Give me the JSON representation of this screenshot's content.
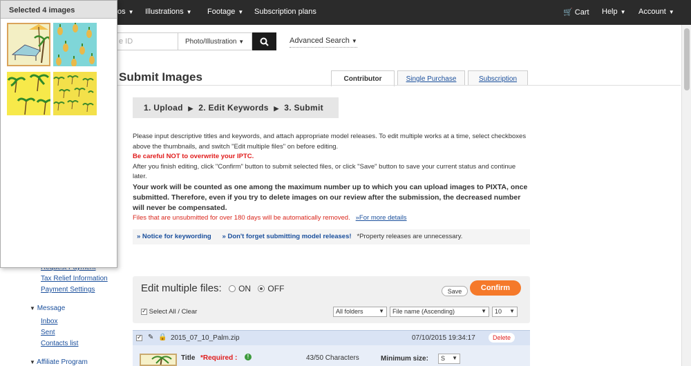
{
  "nav": {
    "items": [
      {
        "label": "os",
        "dropdown": true
      },
      {
        "label": "Illustrations",
        "dropdown": true
      },
      {
        "label": "Footage",
        "dropdown": true
      },
      {
        "label": "Subscription plans",
        "dropdown": false
      }
    ],
    "cart": "Cart",
    "help": "Help",
    "account": "Account"
  },
  "search": {
    "placeholder": "e ID",
    "type_value": "Photo/Illustration",
    "advanced": "Advanced Search"
  },
  "page": {
    "title": "Submit Images",
    "tabs": [
      "Contributor",
      "Single Purchase",
      "Subscription"
    ]
  },
  "steps": {
    "step1": "1. Upload",
    "step2": "2. Edit Keywords",
    "step3": "3. Submit"
  },
  "instructions": {
    "line1": "Please input descriptive titles and keywords, and attach appropriate model releases. To edit multiple works at a time, select checkboxes above the thumbnails, and switch \"Edit multiple files\" on before editing.",
    "warning": "Be careful NOT to overwrite your IPTC.",
    "line2": "After you finish editing, click \"Confirm\" button to submit selected files, or click \"Save\" button to save your current status and continue later.",
    "bold": "Your work will be counted as one among the maximum number up to which you can upload images to PIXTA, once submitted. Therefore, even if you try to delete images on our review after the submission, the decreased number will never be compensated.",
    "removal": "Files that are unsubmitted for over 180 days will be automatically removed.",
    "more_details": "»For more details"
  },
  "notice": {
    "keywording": "» Notice for keywording",
    "releases": "» Don't forget submitting model releases!",
    "property": "*Property releases are unnecessary."
  },
  "sidebar": {
    "partial": "Request Payment",
    "tax": "Tax Relief Information",
    "payment": "Payment Settings",
    "message_heading": "Message",
    "inbox": "Inbox",
    "sent": "Sent",
    "contacts": "Contacts list",
    "affiliate": "Affiliate Program"
  },
  "edit_panel": {
    "title": "Edit multiple files:",
    "on": "ON",
    "off": "OFF",
    "save": "Save",
    "confirm": "Confirm",
    "select_all": "Select All",
    "clear": "Clear",
    "folders": "All folders",
    "sort": "File name (Ascending)",
    "per_page": "10"
  },
  "file": {
    "name": "2015_07_10_Palm.zip",
    "date": "07/10/2015 19:34:17",
    "delete": "Delete",
    "title_label": "Title",
    "required": "*Required :",
    "chars": "43/50 Characters",
    "min_size_label": "Minimum size:",
    "min_size": "S"
  },
  "overlay": {
    "header": "Selected 4 images"
  },
  "colors": {
    "nav_bg": "#2b2b2b",
    "confirm": "#f5792a",
    "warning": "#e01b1b",
    "link": "#1a4f9c"
  }
}
